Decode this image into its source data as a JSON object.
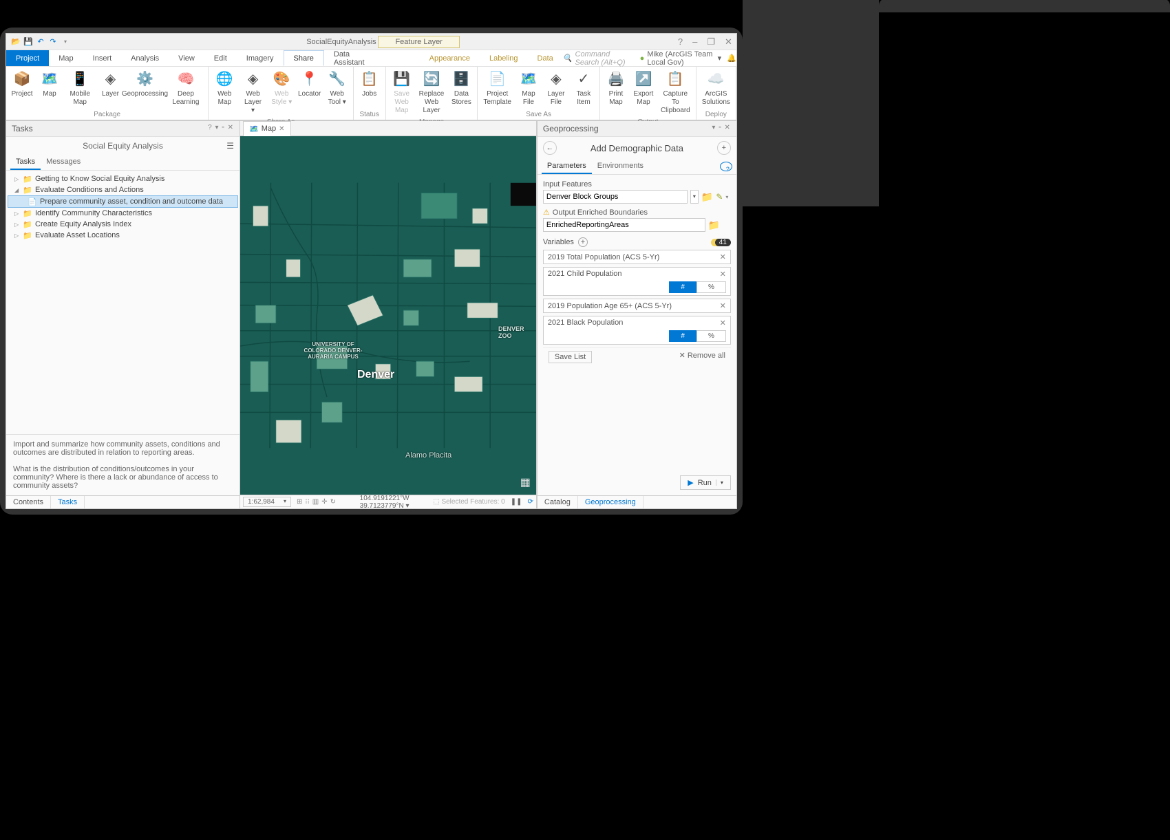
{
  "titlebar": {
    "title": "SocialEquityAnalysis - Map - ArcGIS Pro",
    "context_tab": "Feature Layer",
    "help": "?",
    "restore": "❐",
    "minimize": "–",
    "close": "✕"
  },
  "ribbon_tabs": {
    "project": "Project",
    "tabs": [
      "Map",
      "Insert",
      "Analysis",
      "View",
      "Edit",
      "Imagery",
      "Share",
      "Data Assistant"
    ],
    "active": "Share",
    "ctx_tabs": [
      "Appearance",
      "Labeling",
      "Data"
    ],
    "search_placeholder": "Command Search (Alt+Q)",
    "user": "Mike (ArcGIS Team Local Gov)"
  },
  "ribbon": {
    "groups": [
      {
        "items": [
          "Project",
          "Map",
          "Mobile Map",
          "Layer",
          "Geoprocessing",
          "Deep Learning"
        ],
        "label": "Package"
      },
      {
        "items": [
          "Web Map",
          "Web Layer ▾",
          "Web Style ▾",
          "Locator",
          "Web Tool ▾"
        ],
        "label": "Share As"
      },
      {
        "items": [
          "Jobs"
        ],
        "label": "Status"
      },
      {
        "items": [
          "Save Web Map",
          "Replace Web Layer",
          "Data Stores"
        ],
        "label": "Manage",
        "disabled": [
          0
        ]
      },
      {
        "items": [
          "Project Template",
          "Map File",
          "Layer File",
          "Task Item"
        ],
        "label": "Save As"
      },
      {
        "items": [
          "Print Map",
          "Export Map",
          "Capture To Clipboard"
        ],
        "label": "Output"
      },
      {
        "items": [
          "ArcGIS Solutions"
        ],
        "label": "Deploy"
      }
    ]
  },
  "tasks": {
    "panel_title": "Tasks",
    "panel_controls": "? ▾ ▫ ✕",
    "subtitle": "Social Equity Analysis",
    "tabs": [
      "Tasks",
      "Messages"
    ],
    "active_tab": "Tasks",
    "tree": [
      {
        "arrow": "▷",
        "label": "Getting to Know Social Equity Analysis"
      },
      {
        "arrow": "◢",
        "label": "Evaluate Conditions and Actions"
      },
      {
        "arrow": "",
        "sub": true,
        "selected": true,
        "label": "Prepare community asset, condition and outcome data"
      },
      {
        "arrow": "▷",
        "label": "Identify Community Characteristics"
      },
      {
        "arrow": "▷",
        "label": "Create Equity Analysis Index"
      },
      {
        "arrow": "▷",
        "label": "Evaluate Asset Locations"
      }
    ],
    "desc1": "Import and summarize how community assets, conditions and outcomes are distributed in relation to reporting areas.",
    "desc2": "What is the distribution of conditions/outcomes in your community? Where is there a lack or abundance of access to community assets?",
    "bottom_tabs": {
      "items": [
        "Contents",
        "Tasks"
      ],
      "active": "Tasks"
    }
  },
  "map": {
    "tab_name": "Map",
    "labels": {
      "denver": "Denver",
      "zoo": "DENVER ZOO",
      "campus": "UNIVERSITY OF COLORADO DENVER-AURARIA CAMPUS",
      "alamo": "Alamo Placita"
    }
  },
  "statusbar": {
    "scale": "1:62,984",
    "coords": "104.9191221°W 39.7123779°N",
    "selected": "Selected Features: 0"
  },
  "gp": {
    "panel_title": "Geoprocessing",
    "panel_controls": "▾ ▫ ✕",
    "tool_name": "Add Demographic Data",
    "tabs": [
      "Parameters",
      "Environments"
    ],
    "active_tab": "Parameters",
    "input_features_label": "Input Features",
    "input_features_value": "Denver Block Groups",
    "output_label": "Output Enriched Boundaries",
    "output_value": "EnrichedReportingAreas",
    "variables_label": "Variables",
    "variables_badge": "41",
    "variables": [
      {
        "label": "2019 Total Population (ACS 5-Yr)",
        "toggle": false
      },
      {
        "label": "2021 Child Population",
        "toggle": true
      },
      {
        "label": "2019 Population Age 65+  (ACS 5-Yr)",
        "toggle": false
      },
      {
        "label": "2021 Black Population",
        "toggle": true
      }
    ],
    "toggle_num": "#",
    "toggle_pct": "%",
    "save_list": "Save List",
    "remove_all": "✕ Remove all",
    "run": "Run",
    "bottom_tabs": {
      "items": [
        "Catalog",
        "Geoprocessing"
      ],
      "active": "Geoprocessing"
    }
  }
}
